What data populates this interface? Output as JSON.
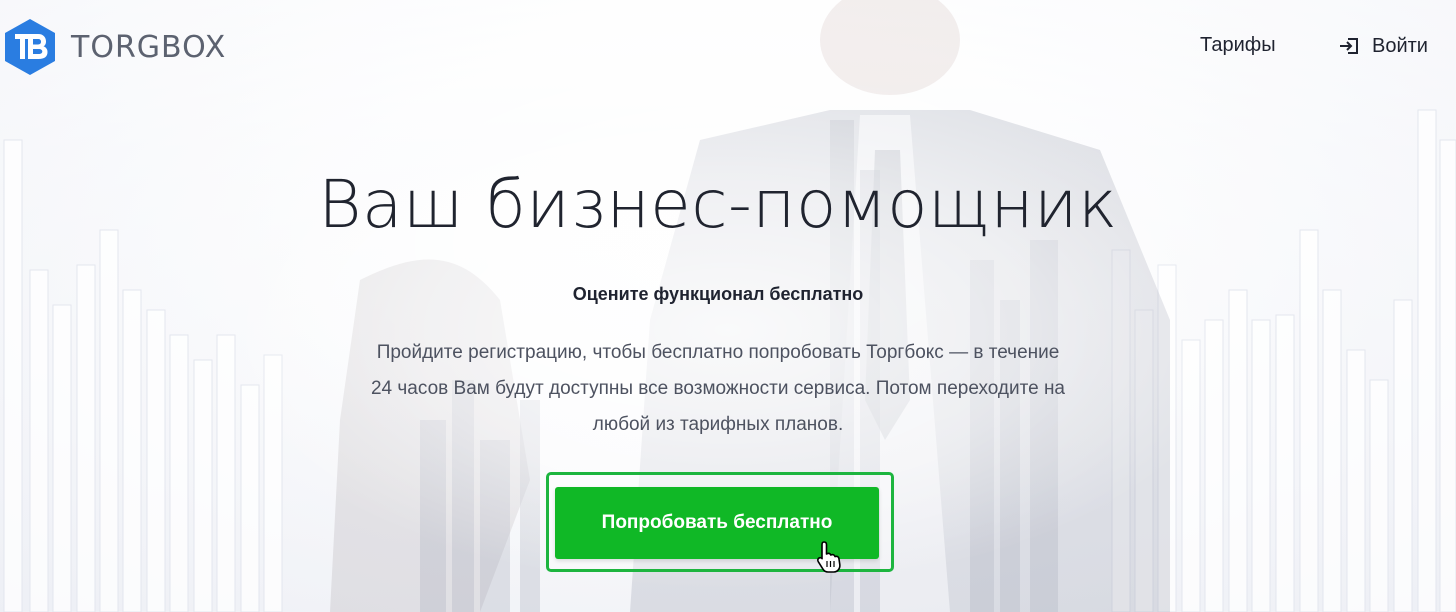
{
  "brand": {
    "name": "TORGBOX",
    "logo_icon": "tb-hexagon-logo-icon",
    "accent_color": "#2a7de1"
  },
  "nav": {
    "tariffs_label": "Тарифы",
    "login_label": "Войти",
    "login_icon": "login-arrow-icon"
  },
  "hero": {
    "title": "Ваш бизнес-помощник",
    "subtitle": "Оцените функционал бесплатно",
    "description": "Пройдите регистрацию, чтобы бесплатно попробовать Торгбокс — в течение 24 часов Вам будут доступны все возможности сервиса. Потом переходите на любой из тарифных планов.",
    "cta_label": "Попробовать бесплатно",
    "cta_color": "#10b826",
    "cta_outline_color": "#1db53f"
  },
  "cursor": {
    "icon": "hand-pointer-icon"
  }
}
